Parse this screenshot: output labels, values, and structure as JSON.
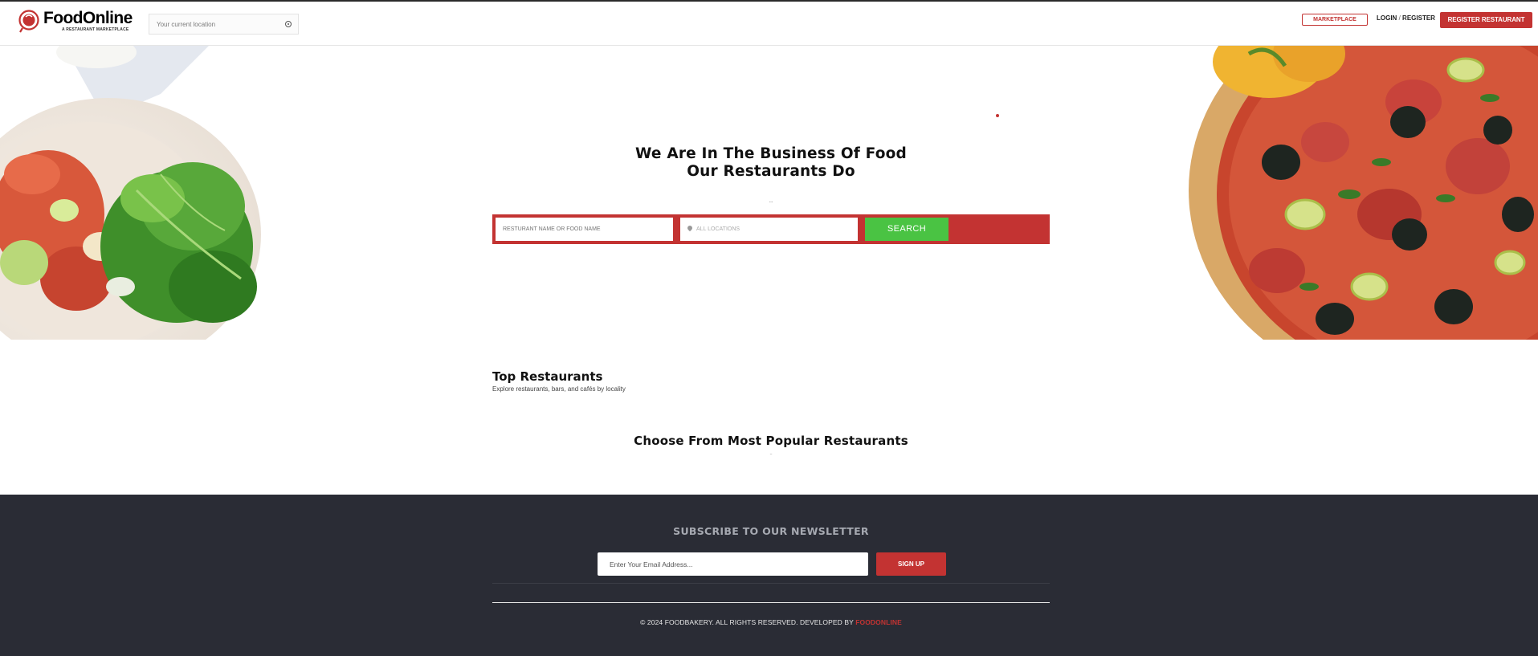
{
  "header": {
    "logo_word": "FoodOnline",
    "logo_tagline": "A RESTAURANT MARKETPLACE",
    "location_placeholder": "Your current location",
    "marketplace_label": "MARKETPLACE",
    "login_label": "LOGIN",
    "register_label": "REGISTER",
    "login_separator": "/",
    "register_restaurant_label": "REGISTER RESTAURANT"
  },
  "hero": {
    "title_line1": "We Are In The Business Of Food",
    "title_line2": "Our Restaurants Do",
    "dots": "..",
    "search": {
      "name_placeholder": "RESTURANT NAME OR FOOD NAME",
      "location_placeholder": "ALL LOCATIONS",
      "button_label": "SEARCH"
    }
  },
  "top_restaurants": {
    "title": "Top Restaurants",
    "subtitle": "Explore restaurants, bars, and cafés by locality"
  },
  "popular": {
    "title": "Choose From Most Popular Restaurants",
    "dots": ".."
  },
  "footer": {
    "newsletter_title": "SUBSCRIBE TO OUR NEWSLETTER",
    "email_placeholder": "Enter Your Email Address...",
    "signup_label": "SIGN UP",
    "copyright_text": "© 2024 FOODBAKERY. ALL RIGHTS RESERVED. DEVELOPED BY ",
    "copyright_brand": "FOODONLINE"
  },
  "colors": {
    "brand_red": "#c33332",
    "search_green": "#4ac343",
    "footer_bg": "#2a2c35"
  }
}
